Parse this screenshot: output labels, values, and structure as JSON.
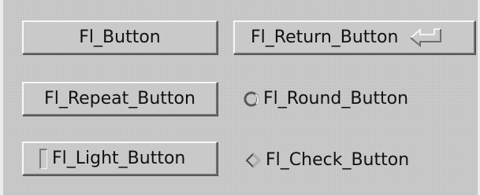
{
  "buttons": {
    "button": "Fl_Button",
    "return_button": "Fl_Return_Button",
    "repeat_button": "Fl_Repeat_Button",
    "round_button": "Fl_Round_Button",
    "light_button": "Fl_Light_Button",
    "check_button": "Fl_Check_Button"
  },
  "icons": {
    "return": "return-arrow-icon",
    "round": "radio-circle-icon",
    "light": "light-indicator-icon",
    "check": "diamond-check-icon"
  },
  "colors": {
    "background": "#c8c8c8",
    "button_face": "#c9c9c9",
    "text": "#111111"
  }
}
